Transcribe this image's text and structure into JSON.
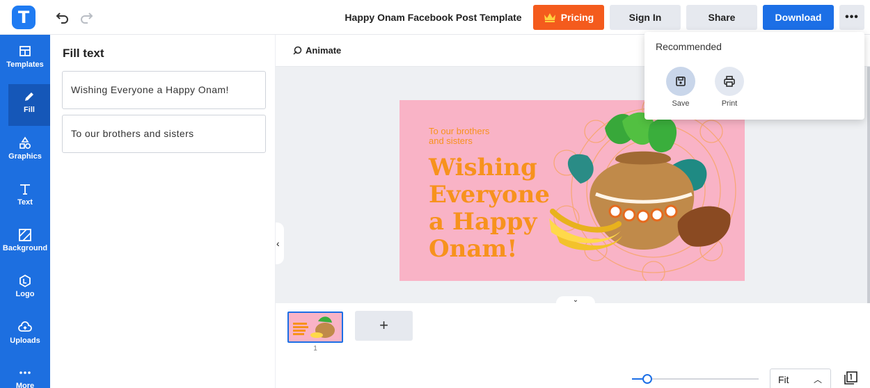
{
  "app": {
    "logo_letter": "T",
    "document_title": "Happy Onam Facebook Post Template"
  },
  "topbar": {
    "pricing_label": "Pricing",
    "signin_label": "Sign In",
    "share_label": "Share",
    "download_label": "Download",
    "more_label": "•••"
  },
  "rail": {
    "items": [
      {
        "label": "Templates",
        "icon": "templates-icon"
      },
      {
        "label": "Fill",
        "icon": "pencil-icon",
        "active": true
      },
      {
        "label": "Graphics",
        "icon": "shapes-icon"
      },
      {
        "label": "Text",
        "icon": "text-icon"
      },
      {
        "label": "Background",
        "icon": "background-icon"
      },
      {
        "label": "Logo",
        "icon": "logo-icon"
      },
      {
        "label": "Uploads",
        "icon": "upload-cloud-icon"
      },
      {
        "label": "More",
        "icon": "more-icon"
      }
    ]
  },
  "panel": {
    "title": "Fill text",
    "fields": [
      "Wishing Everyone a Happy Onam!",
      "To our brothers and sisters"
    ]
  },
  "toolbar": {
    "animate_label": "Animate"
  },
  "design": {
    "subtitle_line1": "To our brothers",
    "subtitle_line2": "and sisters",
    "headline_line1": "Wishing",
    "headline_line2": "Everyone",
    "headline_line3": "a Happy",
    "headline_line4": "Onam!",
    "background_color": "#f9b3c6",
    "text_color": "#f7921d"
  },
  "pages": {
    "thumb_number": "1",
    "add_label": "+",
    "zoom_label": "Fit",
    "zoom_level": 0.12
  },
  "popup": {
    "title": "Recommended",
    "save_label": "Save",
    "print_label": "Print"
  },
  "colors": {
    "brand_blue": "#1c6fe6",
    "pricing_orange": "#f45b1d"
  }
}
